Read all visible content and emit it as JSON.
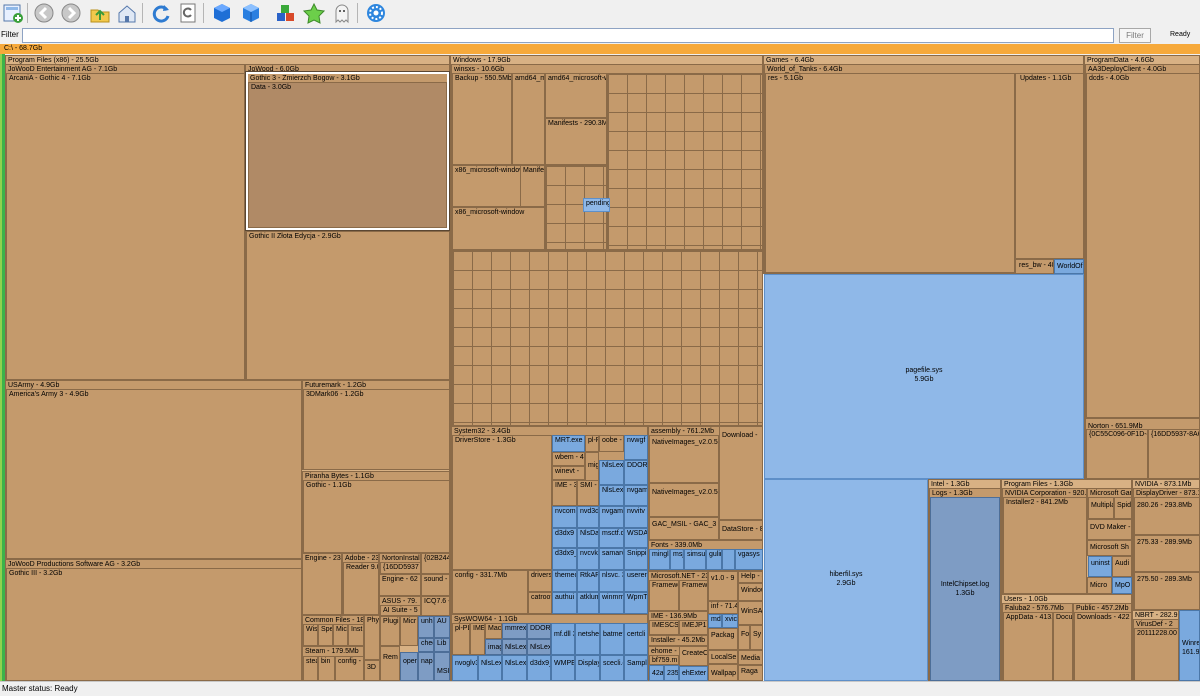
{
  "toolbar": {
    "buttons": [
      {
        "name": "add-scan-icon"
      },
      {
        "name": "back-icon"
      },
      {
        "name": "forward-icon"
      },
      {
        "name": "up-folder-icon"
      },
      {
        "name": "home-icon"
      },
      {
        "name": "refresh-icon"
      },
      {
        "name": "reload-file-icon"
      },
      {
        "name": "cube-view-icon"
      },
      {
        "name": "cube-alt-icon"
      },
      {
        "name": "blocks-icon"
      },
      {
        "name": "star-icon"
      },
      {
        "name": "ghost-icon"
      },
      {
        "name": "settings-icon"
      }
    ]
  },
  "filter": {
    "label": "Filter",
    "value": "",
    "button": "Filter",
    "status": "Ready"
  },
  "root": {
    "label": "C:\\ - 68.7Gb"
  },
  "treemap": {
    "program_files_x86": "Program Files (x86) - 25.5Gb",
    "jowood_ent": "JoWooD Entertainment AG - 7.1Gb",
    "arcania": "ArcaniA - Gothic 4 - 7.1Gb",
    "jowood": "JoWood - 6.0Gb",
    "gothic3": "Gothic 3 - Zmierzch Bogow - 3.1Gb",
    "data": "Data - 3.0Gb",
    "gothic2": "Gothic II Złota Edycja - 2.9Gb",
    "usarmy": "USArmy - 4.9Gb",
    "americas_army": "America's Army 3 - 4.9Gb",
    "futuremark": "Futuremark - 1.2Gb",
    "mark06": "3DMark06 - 1.2Gb",
    "piranha": "Piranha Bytes - 1.1Gb",
    "gothic": "Gothic - 1.1Gb",
    "jowood_prod": "JoWooD Productions Software AG - 3.2Gb",
    "gothic3b": "Gothic III - 3.2Gb",
    "engine23": "Engine - 23",
    "adobe": "Adobe - 233",
    "reader9": "Reader 9.0",
    "norton_inst": "NortonInstal",
    "norton_guid": "{16DD5937",
    "guid2": "{02B244",
    "engine62": "Engine - 62",
    "sound": "sound -",
    "asus": "ASUS - 79.",
    "ai_suite": "AI Suite - 5",
    "icq": "ICQ7.6 -",
    "common_files": "Common Files - 185",
    "wise": "Wise",
    "spe": "Spe",
    "mic": "Mic",
    "inst": "Inst",
    "phy": "Phy",
    "plugi": "Plugi",
    "micr": "Micr",
    "steam": "Steam - 179.5Mb",
    "steam2": "steam",
    "bin": "bin",
    "config": "config -",
    "d3d": "3D",
    "rem": "Rem",
    "unh": "unh 4Kb",
    "au": "AU 5.2",
    "chee": "chee",
    "lib": "Lib",
    "napi": "napi",
    "oper": "oper 13.6",
    "msi": "MSI",
    "windows": "Windows - 17.9Gb",
    "winsxs": "winsxs - 10.6Gb",
    "backup": "Backup - 550.5Mb",
    "amd64_m": "amd64_m",
    "amd64_ms": "amd64_microsoft-wi",
    "manifests": "Manifests - 290.3Mb",
    "x86_ms1": "x86_microsoft-window",
    "x86_ms2": "x86_microsoft-window",
    "manife": "Manife",
    "pending": "pending",
    "system32": "System32 - 3.4Gb",
    "driverstore": "DriverStore - 1.3Gb",
    "mrt": "MRT.exe",
    "plpl": "pl-PL",
    "oobe": "oobe -",
    "nvwgf": "nvwgf 7.9Mb",
    "wbem": "wbem - 4",
    "migv": "migv",
    "winevt": "winevt -",
    "nlslex1": "NlsLexi 11.1Mb",
    "ddor": "DDOR 5.9Mb",
    "ime": "IME - 3",
    "smi": "SMI - 2",
    "nlslex2": "NlsLexi 5.7Mb",
    "nvgam1": "nvgam 4.4Mb",
    "nvcomp": "nvcomp 23.5Mb",
    "nvd3du": "nvd3du 14.3Mb",
    "nvgam2": "nvgam 4.9Mb",
    "nvvitv": "nvvitv 4.3Mb",
    "d3dx9a": "d3dx9 3.6Mb",
    "nlsdat": "NlsDat 3.0Mb",
    "mscti": "msctf.d 1.0Mb",
    "wsda": "WSDA 564Kb",
    "d3dx9b": "d3dx9_ 3.3Mb",
    "nvcvk": "nvcvk 2.4Mb",
    "samarv": "samarv 744Kb",
    "snippi": "Snippi 424Kb",
    "config331": "config - 331.7Mb",
    "drivers": "drivers",
    "catroot": "catroot",
    "themec": "themec 2.0Mb",
    "rtkap": "RtkAPI 1.5Mb",
    "nlsvc": "nlsvc. 300Kb",
    "userenv": "useren 108Kb",
    "authui": "authui 1.8Mb",
    "atklum": "atklum 1.2Mb",
    "winmm": "winmm 200Kb",
    "wpmtv": "WpmTv 4Kb",
    "assembly": "assembly - 761.2Mb",
    "native1": "NativeImages_v2.0.5",
    "native2": "NativeImages_v2.0.5",
    "gac_msil": "GAC_MSIL - GAC_3",
    "download": "Download -",
    "datastore": "DataStore - 8",
    "fonts": "Fonts - 339.0Mb",
    "mingli": "mingli 30.7Mb",
    "msj": "msj 20.M",
    "simsun": "simsun 14.6Mb",
    "gulin": "gulin 12.8",
    "vgasys": "vgasys 8Kb",
    "netfx": "Microsoft.NET - 23",
    "framew1": "Framewc",
    "framew2": "Framew",
    "v10": "v1.0 - 9",
    "help": "Help - 8",
    "window": "Window",
    "ime136": "IME - 136.9Mb",
    "imescs": "IMESCS",
    "imejp": "IMEJP1",
    "installer": "Installer - 45.2Mb",
    "inf": "inf - 71.4",
    "mdr": "mdr",
    "xvic": "xvic",
    "winsa": "WinSA",
    "syswow": "SysWOW64 - 1.1Gb",
    "plpl2": "pl-PL",
    "ime2": "IME",
    "macr": "Macr",
    "mmrex": "mmrex-",
    "ddor2": "DDOR",
    "mfdll": "mf.dll 3.0Mb",
    "netshel": "netshel 2.3Mb",
    "batmet": "batmet 724Kb",
    "certcli": "certcli 336Kb",
    "imag": "imag",
    "nlslex3": "NlsLexi",
    "nlslex4": "NlsLexi",
    "nvogl": "nvoglv3 15.8Mb",
    "nlslex5": "NlsLexi 9.4Mb",
    "nlslex6": "NlsLexi 4.8Mb",
    "d3dx9c": "d3dx9_ 3.2Mb",
    "wmpef": "WMPEf 1.5Mb",
    "display": "Display 1016Kb",
    "scecli": "scecli.dl 172Kb",
    "sample": "Sample 4Kb",
    "ehome": "ehome -",
    "bf759": "bf759.m",
    "createc": "CreateC",
    "localse": "LocalSe",
    "media": "Media -",
    "raga": "Raga",
    "wallpap": "Wallpap",
    "package": "Packag",
    "fo": "Fo",
    "sy": "Sy",
    "n42a": "42a",
    "n235": "235",
    "ehexter": "ehExter",
    "games": "Games - 6.4Gb",
    "wot": "World_of_Tanks - 6.4Gb",
    "res": "res - 5.1Gb",
    "updates": "Updates - 1.1Gb",
    "res_bw": "res_bw - 40",
    "worldof": "WorldOf",
    "pagefile": "pagefile.sys",
    "pagefile_size": "5.9Gb",
    "hiberfil": "hiberfil.sys",
    "hiberfil_size": "2.9Gb",
    "programdata": "ProgramData - 4.6Gb",
    "aa3": "AA3DeployClient - 4.0Gb",
    "dcds": "dcds - 4.0Gb",
    "norton": "Norton - 651.9Mb",
    "norton_guid2": "{0C55C096-0F1D-4F",
    "norton_guid3": "{16DD5937-8A6",
    "intel": "Intel - 1.3Gb",
    "logs": "Logs - 1.3Gb",
    "intelchipset": "IntelChipset.log",
    "intelchipset_size": "1.3Gb",
    "program_files": "Program Files - 1.3Gb",
    "nvidia_corp": "NVIDIA Corporation - 920.",
    "installer2": "Installer2 - 841.2Mb",
    "ms_gam": "Microsoft Gam",
    "multipla": "Multipla",
    "spid": "Spid",
    "dvd": "DVD Maker -",
    "ms_sh": "Microsoft Sh",
    "uninst": "uninst 88Kb",
    "audi": "Audi",
    "micro": "Micro",
    "mpo": "MpO",
    "users": "Users - 1.0Gb",
    "faluba": "Faluba2 - 576.7Mb",
    "appdata": "AppData - 413.",
    "docu": "Docu",
    "public": "Public - 457.2Mb",
    "downloads": "Downloads - 422",
    "nvidia": "NVIDIA - 873.1Mb",
    "displaydriver": "DisplayDriver - 873.1",
    "dd1": "280.26 - 293.8Mb",
    "dd2": "275.33 - 289.9Mb",
    "dd3": "275.50 - 289.3Mb",
    "nbrt": "NBRT - 282.9",
    "virusdef": "VirusDef - 2",
    "virusdef2": "20111228.00",
    "wine": "Winre. 161.9"
  },
  "status": {
    "text": "Master status: Ready"
  }
}
